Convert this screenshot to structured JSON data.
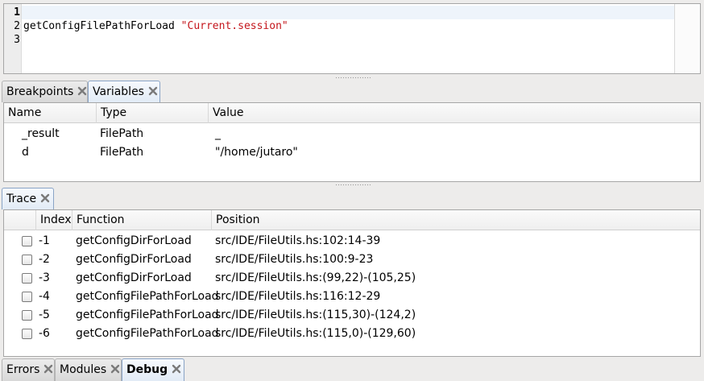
{
  "editor": {
    "line_numbers": [
      "1",
      "2",
      "3"
    ],
    "line2_func": "getConfigFilePathForLoad",
    "line2_string": "\"Current.session\""
  },
  "top_tabs": [
    {
      "label": "Breakpoints",
      "active": false
    },
    {
      "label": "Variables",
      "active": true
    }
  ],
  "variables": {
    "columns": [
      "Name",
      "Type",
      "Value"
    ],
    "rows": [
      {
        "name": "_result",
        "type": "FilePath",
        "value": "_"
      },
      {
        "name": "d",
        "type": "FilePath",
        "value": "\"/home/jutaro\""
      }
    ]
  },
  "trace_tab": {
    "label": "Trace",
    "active": true
  },
  "trace": {
    "columns": [
      "Index",
      "Function",
      "Position"
    ],
    "rows": [
      {
        "index": "-1",
        "function": "getConfigDirForLoad",
        "position": "src/IDE/FileUtils.hs:102:14-39"
      },
      {
        "index": "-2",
        "function": "getConfigDirForLoad",
        "position": "src/IDE/FileUtils.hs:100:9-23"
      },
      {
        "index": "-3",
        "function": "getConfigDirForLoad",
        "position": "src/IDE/FileUtils.hs:(99,22)-(105,25)"
      },
      {
        "index": "-4",
        "function": "getConfigFilePathForLoad",
        "position": "src/IDE/FileUtils.hs:116:12-29"
      },
      {
        "index": "-5",
        "function": "getConfigFilePathForLoad",
        "position": "src/IDE/FileUtils.hs:(115,30)-(124,2)"
      },
      {
        "index": "-6",
        "function": "getConfigFilePathForLoad",
        "position": "src/IDE/FileUtils.hs:(115,0)-(129,60)"
      }
    ]
  },
  "bottom_tabs": [
    {
      "label": "Errors",
      "active": false
    },
    {
      "label": "Modules",
      "active": false
    },
    {
      "label": "Debug",
      "active": true
    }
  ],
  "icons": {
    "tab_close": "close-icon"
  }
}
